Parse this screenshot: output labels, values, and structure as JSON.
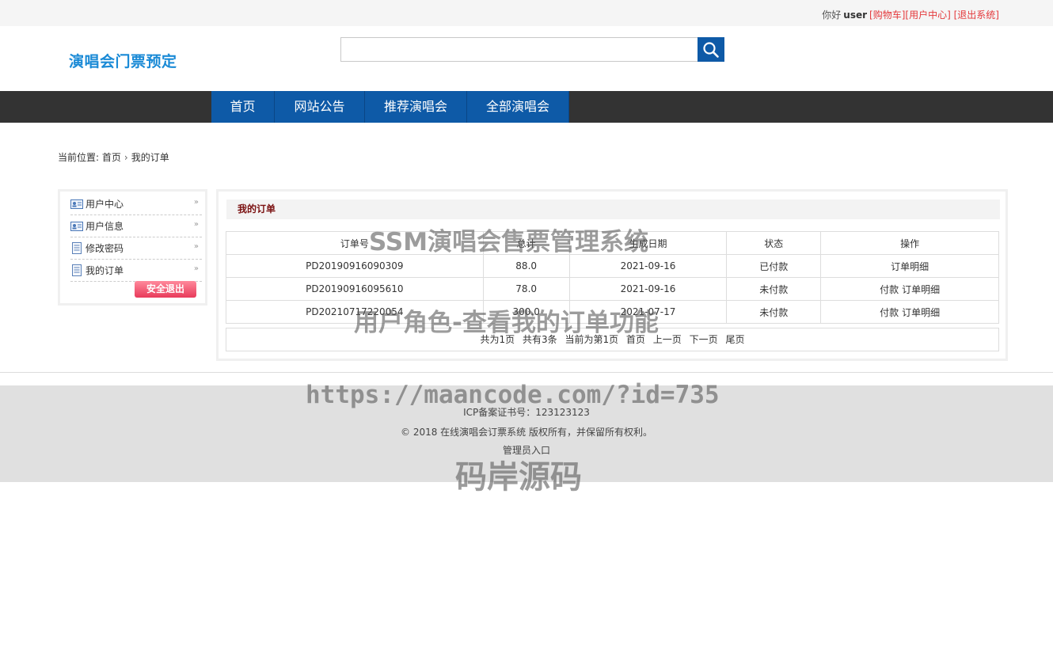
{
  "topbar": {
    "greeting": "你好",
    "username": "user",
    "cart_link": "[购物车]",
    "user_center_link": "[用户中心]",
    "logout_link": "[退出系统]"
  },
  "header": {
    "logo": "演唱会门票预定",
    "search": {
      "value": "",
      "placeholder": ""
    }
  },
  "nav": {
    "items": [
      {
        "label": "首页"
      },
      {
        "label": "网站公告"
      },
      {
        "label": "推荐演唱会"
      },
      {
        "label": "全部演唱会"
      }
    ]
  },
  "breadcrumb": {
    "prefix": "当前位置:",
    "home": "首页",
    "separator": "›",
    "current": "我的订单"
  },
  "sidebar": {
    "items": [
      {
        "label": "用户中心",
        "icon": "id-card-icon"
      },
      {
        "label": "用户信息",
        "icon": "id-card-icon"
      },
      {
        "label": "修改密码",
        "icon": "document-icon"
      },
      {
        "label": "我的订单",
        "icon": "document-icon"
      }
    ],
    "logout_button": "安全退出"
  },
  "orders": {
    "title": "我的订单",
    "columns": [
      "订单号",
      "总计",
      "生成日期",
      "状态",
      "操作"
    ],
    "rows": [
      {
        "order_no": "PD20190916090309",
        "total": "88.0",
        "date": "2021-09-16",
        "status": "已付款",
        "pay": "",
        "detail": "订单明细"
      },
      {
        "order_no": "PD20190916095610",
        "total": "78.0",
        "date": "2021-09-16",
        "status": "未付款",
        "pay": "付款",
        "detail": "订单明细"
      },
      {
        "order_no": "PD20210717220054",
        "total": "300.0",
        "date": "2021-07-17",
        "status": "未付款",
        "pay": "付款",
        "detail": "订单明细"
      }
    ],
    "pager": {
      "total_pages": "共为1页",
      "total_records": "共有3条",
      "current_page": "当前为第1页",
      "first": "首页",
      "prev": "上一页",
      "next": "下一页",
      "last": "尾页"
    }
  },
  "footer": {
    "icp": "ICP备案证书号：123123123",
    "copyright": "© 2018 在线演唱会订票系统 版权所有，并保留所有权利。",
    "admin_link": "管理员入口"
  },
  "watermarks": {
    "title": "SSM演唱会售票管理系统",
    "subtitle": "用户角色-查看我的订单功能",
    "url": "https://maancode.com/?id=735",
    "brand": "码岸源码"
  },
  "colors": {
    "primary_blue": "#0e5aa7",
    "nav_dark": "#333333",
    "logo_blue": "#1a8ad6",
    "link_red": "#e4393c"
  }
}
